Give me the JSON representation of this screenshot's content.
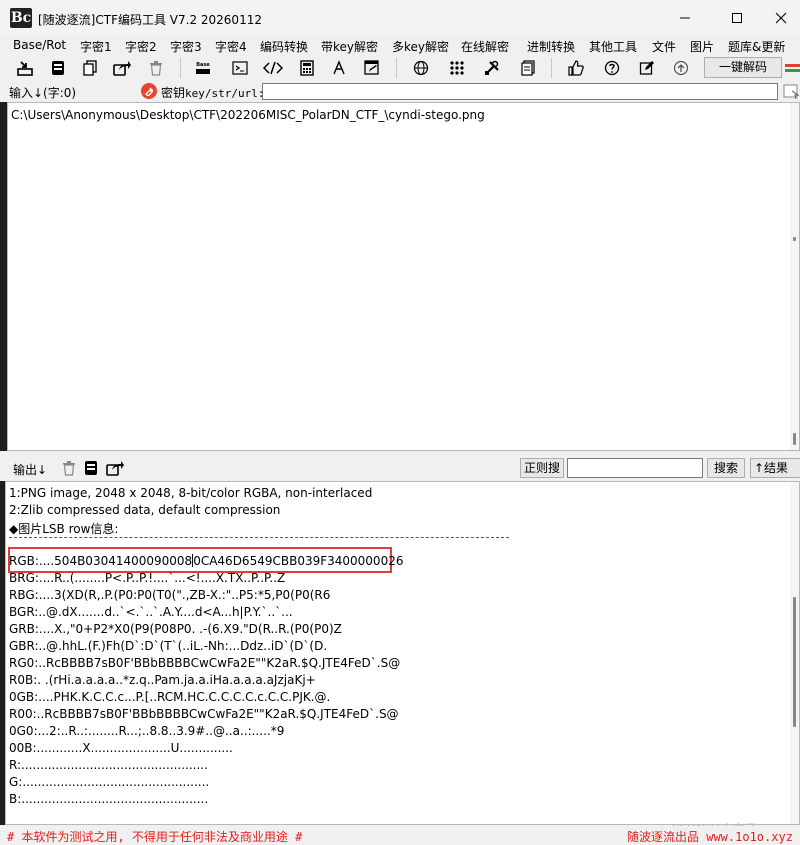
{
  "window": {
    "logo_text": "Bc",
    "title": "[随波逐流]CTF编码工具 V7.2  20260112"
  },
  "menu": [
    "Base/Rot",
    "字密1",
    "字密2",
    "字密3",
    "字密4",
    "编码转换",
    "带key解密",
    "多key解密",
    "在线解密",
    "进制转换",
    "其他工具",
    "文件",
    "图片",
    "题库&更新"
  ],
  "toolbar": {
    "base_icon_text": "Base",
    "decode_label": "一键解码"
  },
  "input": {
    "label": "输入↓(字:0)",
    "key_label_cn": "密钥",
    "key_label_en": "key/str/url:",
    "key_value": "",
    "content": "C:\\Users\\Anonymous\\Desktop\\CTF\\202206MISC_PolarDN_CTF_\\cyndi-stego.png"
  },
  "output": {
    "label": "输出↓",
    "regex_label": "正则搜",
    "search_value": "",
    "search_label": "搜索",
    "result_label": "↑结果",
    "lines": [
      "1:PNG image, 2048 x 2048, 8-bit/color RGBA, non-interlaced",
      "2:Zlib compressed data, default compression",
      "◆图片LSB row信息:"
    ],
    "rgb_line_a": "RGB:....504B03041400090008",
    "rgb_line_b": "0CA46D6549CBB039F3400000026",
    "channel_lines": [
      "BRG:....R..(........P<.P..P.!....`...<!....X.TX..P..P..Z",
      "RBG:....3(XD(R,.P.(P0:P0(T0(\".,ZB-X.:\"..P5:*5,P0(P0(R6",
      "BGR:..@.dX.......d..`<.`..`.A.Y....d<A...h|P.Y.`..`...",
      "GRB:....X.,\"0+P2*X0(P9(P08P0. .-(6.X9.\"D(R..R.(P0(P0)Z",
      "GBR:..@.hhL.(F.)Fh(D`:D`(T`(..iL.-Nh:...Ddz..iD`(D`(D.",
      "RG0:..RcBBBB7sB0F'BBbBBBBCwCwFa2E\"\"K2aR.$Q.JTE4FeD`.S@",
      "R0B:. .(rHi.a.a.a.a..*z.q..Pam.ja.a.iHa.a.a.a.aJzjaKj+",
      "0GB:....PHK.K.C.C.c...P.[..RCM.HC.C.C.C.C.c.C.C.PJK.@.",
      "R00:..RcBBBB7sB0F'BBbBBBBCwCwFa2E\"\"K2aR.$Q.JTE4FeD`.S@",
      "0G0:...2:..R..:........R...;..8.8..3.9#..@..a..:.....*9",
      "00B:............X.....................U..............",
      "R:.................................................",
      "G:.................................................",
      "B:................................................."
    ]
  },
  "status": {
    "left": "# 本软件为测试之用, 不得用于任何非法及商业用途 #",
    "right": "随波逐流出品 www.1o1o.xyz",
    "watermark": "CSDN @大东子"
  },
  "colors": {
    "highlight": "#e23b3b",
    "status_text": "#e02020",
    "key_icon": "#e8432f"
  }
}
